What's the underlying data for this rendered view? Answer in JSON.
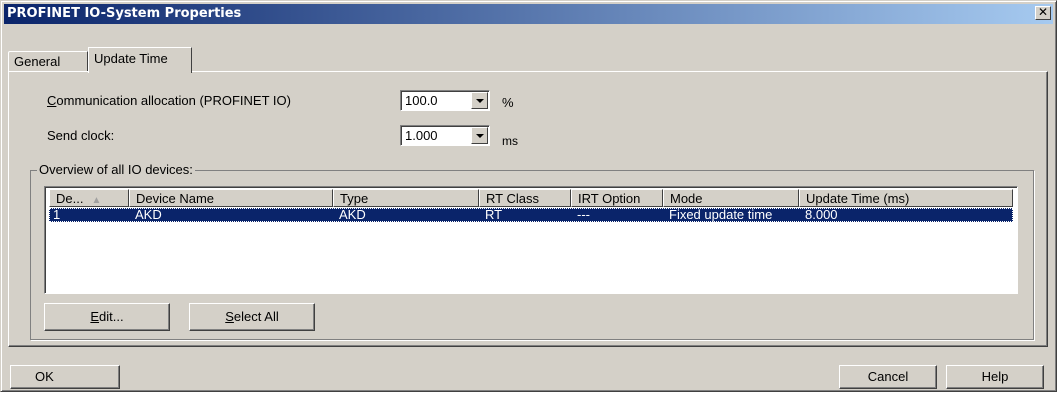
{
  "window": {
    "title": "PROFINET IO-System Properties",
    "close_glyph": "✕"
  },
  "tabs": [
    {
      "label": "General",
      "active": false
    },
    {
      "label": "Update Time",
      "active": true
    }
  ],
  "communication": {
    "label_first": "C",
    "label_rest": "ommunication allocation (PROFINET IO)",
    "value": "100.0",
    "unit": "%"
  },
  "send_clock": {
    "label": "Send clock:",
    "value": "1.000",
    "unit": "ms"
  },
  "overview": {
    "title": "Overview of all IO devices:",
    "columns": [
      "De...",
      "Device Name",
      "Type",
      "RT Class",
      "IRT Option",
      "Mode",
      "Update Time (ms)"
    ],
    "sort_icon": "sort-ascending-icon",
    "rows": [
      {
        "cells": [
          "1",
          "AKD",
          "AKD",
          "RT",
          "---",
          "Fixed update time",
          "8.000"
        ],
        "selected": true
      }
    ]
  },
  "buttons": {
    "edit_first": "E",
    "edit_rest": "dit...",
    "select_all_first": "S",
    "select_all_rest": "elect All",
    "ok": "OK",
    "cancel": "Cancel",
    "help": "Help"
  },
  "colors": {
    "selection": "#0a246a",
    "dialog_face": "#d4d0c8",
    "title_gradient_start": "#0a246a",
    "title_gradient_end": "#a6caf0"
  }
}
